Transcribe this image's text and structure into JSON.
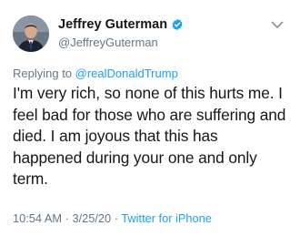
{
  "author": {
    "display_name": "Jeffrey Guterman",
    "handle": "@JeffreyGuterman",
    "verified": true
  },
  "reply": {
    "prefix": "Replying to ",
    "to": "@realDonaldTrump"
  },
  "tweet": {
    "text": "I'm very rich, so none of this hurts me. I feel bad for those who are suffering and died. I am joyous that this has happened during your one and only term."
  },
  "meta": {
    "time": "10:54 AM",
    "date": "3/25/20",
    "sep": " · ",
    "source": "Twitter for iPhone"
  },
  "icons": {
    "verified": "verified-badge-icon",
    "more": "chevron-down-icon"
  },
  "colors": {
    "link": "#1da1f2",
    "secondary_text": "#657786",
    "primary_text": "#14171a"
  }
}
